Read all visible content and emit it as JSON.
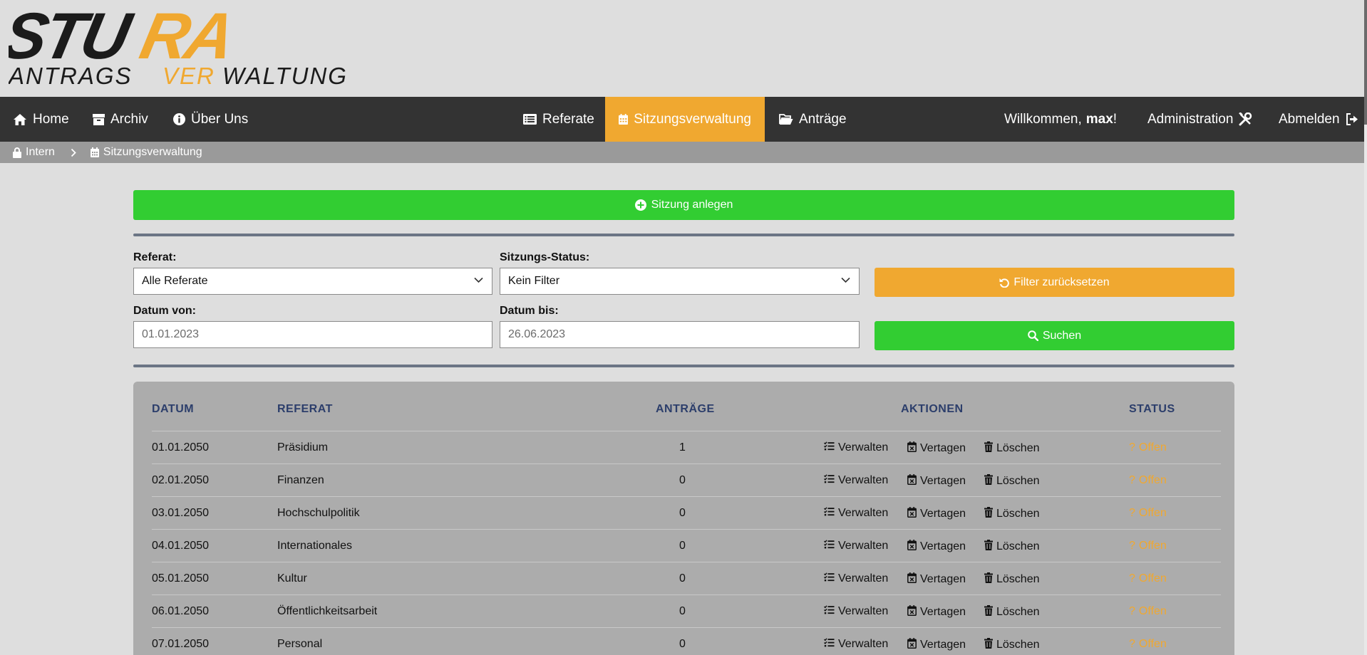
{
  "logo": {
    "line1_a": "STU",
    "line1_b": "RA",
    "line2_a": "ANTRAGS",
    "line2_b": "VER",
    "line2_c": "WALTUNG"
  },
  "nav": {
    "left": [
      {
        "label": "Home",
        "icon": "home-icon"
      },
      {
        "label": "Archiv",
        "icon": "archive-icon"
      },
      {
        "label": "Über Uns",
        "icon": "info-icon"
      }
    ],
    "center": [
      {
        "label": "Referate",
        "icon": "list-icon"
      },
      {
        "label": "Sitzungsverwaltung",
        "icon": "calendar-icon",
        "active": true
      },
      {
        "label": "Anträge",
        "icon": "folder-open-icon"
      }
    ],
    "welcome_prefix": "Willkommen,",
    "welcome_user": "max",
    "welcome_suffix": "!",
    "admin": "Administration",
    "logout": "Abmelden"
  },
  "breadcrumb": {
    "items": [
      "Intern",
      "Sitzungsverwaltung"
    ]
  },
  "actions": {
    "create": "Sitzung anlegen"
  },
  "filters": {
    "referat_label": "Referat:",
    "referat_value": "Alle Referate",
    "status_label": "Sitzungs-Status:",
    "status_value": "Kein Filter",
    "reset": "Filter zurücksetzen",
    "date_from_label": "Datum von:",
    "date_from_placeholder": "01.01.2023",
    "date_to_label": "Datum bis:",
    "date_to_placeholder": "26.06.2023",
    "search": "Suchen"
  },
  "table": {
    "headers": [
      "DATUM",
      "REFERAT",
      "ANTRÄGE",
      "AKTIONEN",
      "STATUS"
    ],
    "action_labels": {
      "manage": "Verwalten",
      "postpone": "Vertagen",
      "delete": "Löschen"
    },
    "rows": [
      {
        "date": "01.01.2050",
        "referat": "Präsidium",
        "count": "1",
        "status": "Offen"
      },
      {
        "date": "02.01.2050",
        "referat": "Finanzen",
        "count": "0",
        "status": "Offen"
      },
      {
        "date": "03.01.2050",
        "referat": "Hochschulpolitik",
        "count": "0",
        "status": "Offen"
      },
      {
        "date": "04.01.2050",
        "referat": "Internationales",
        "count": "0",
        "status": "Offen"
      },
      {
        "date": "05.01.2050",
        "referat": "Kultur",
        "count": "0",
        "status": "Offen"
      },
      {
        "date": "06.01.2050",
        "referat": "Öffentlichkeitsarbeit",
        "count": "0",
        "status": "Offen"
      },
      {
        "date": "07.01.2050",
        "referat": "Personal",
        "count": "0",
        "status": "Offen"
      }
    ],
    "status_icon": "?"
  },
  "colors": {
    "accent": "#f0a830",
    "green": "#32cd32",
    "nav": "#333333",
    "breadcrumb": "#9a9a9a",
    "header_text": "#2c3e6b"
  }
}
